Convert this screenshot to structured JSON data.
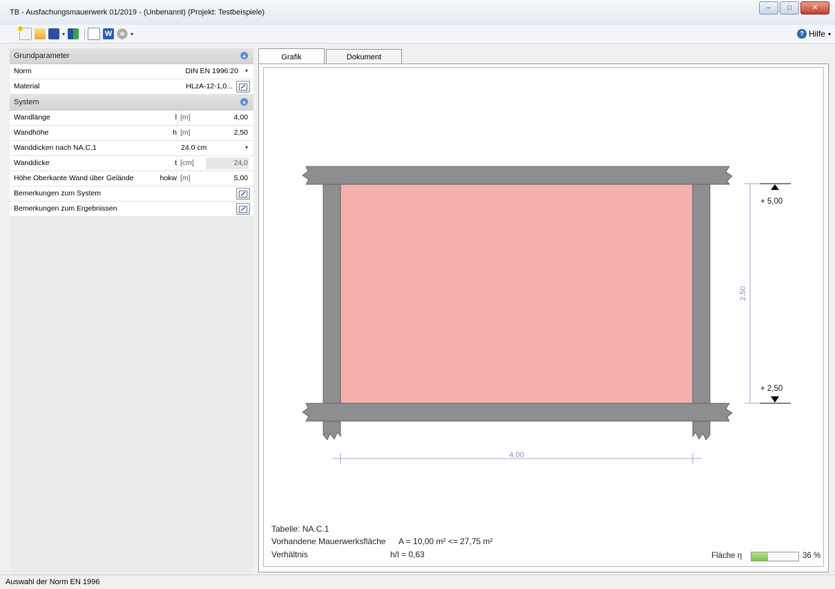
{
  "window": {
    "title": "TB - Ausfachungsmauerwerk 01/2019 - (Unbenannt) (Projekt: Testbeispiele)",
    "minimize": "–",
    "maximize": "□",
    "close": "✕"
  },
  "toolbar": {
    "help_label": "Hilfe",
    "help_icon": "?"
  },
  "panel": {
    "group1": "Grundparameter",
    "norm": {
      "label": "Norm",
      "value": "DIN EN 1996:20"
    },
    "material": {
      "label": "Material",
      "value": "HLzA-12-1,0..."
    },
    "group2": "System",
    "wandlaenge": {
      "label": "Wandlänge",
      "sym": "l",
      "unit": "[m]",
      "value": "4,00"
    },
    "wandhoehe": {
      "label": "Wandhöhe",
      "sym": "h",
      "unit": "[m]",
      "value": "2,50"
    },
    "wanddicken": {
      "label": "Wanddicken nach NA.C.1",
      "value": "24.0 cm"
    },
    "wanddicke": {
      "label": "Wanddicke",
      "sym": "t",
      "unit": "[cm]",
      "value": "24,0"
    },
    "hoehe": {
      "label": "Höhe Oberkante Wand über Gelände",
      "sym": "hokw",
      "unit": "[m]",
      "value": "5,00"
    },
    "bem_system": {
      "label": "Bemerkungen zum System"
    },
    "bem_ergebnis": {
      "label": "Bemerkungen zum Ergebnissen"
    }
  },
  "tabs": {
    "grafik": "Grafik",
    "dokument": "Dokument"
  },
  "drawing": {
    "top_level": "+ 5,00",
    "bottom_level": "+ 2,50",
    "height_dim": "2,50",
    "width_dim": "4,00",
    "fill_color": "#f4b0ad",
    "frame_color": "#8c8e90"
  },
  "info": {
    "tabelle": "Tabelle: NA.C.1",
    "flaeche_label": "Vorhandene Mauerwerksfläche",
    "flaeche_eq": "A  =  10,00  m²  <= 27,75 m²",
    "verh_label": "Verhältnis",
    "verh_eq": "h/l =    0,63",
    "progress_label": "Fläche η",
    "progress_value": "36 %",
    "progress_fraction": 0.36
  },
  "status": "Auswahl der Norm EN 1996"
}
